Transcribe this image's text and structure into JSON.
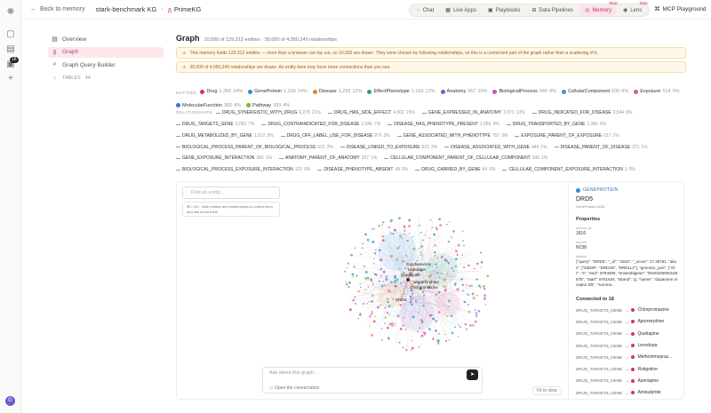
{
  "topbar": {
    "back_label": "Back to memory",
    "memory_name": "stark-benchmark KG",
    "current": "PrimeKG",
    "tabs": [
      {
        "label": "Chat",
        "beta": ""
      },
      {
        "label": "Live Apps",
        "beta": ""
      },
      {
        "label": "Playbooks",
        "beta": ""
      },
      {
        "label": "Data Pipelines",
        "beta": ""
      },
      {
        "label": "Memory",
        "beta": "Beta"
      },
      {
        "label": "Lens",
        "beta": "Beta"
      }
    ],
    "active_tab": "Memory",
    "mcp_label": "MCP Playground"
  },
  "rail": {
    "badge": "18",
    "avatar": "G"
  },
  "sidebar": {
    "items": [
      {
        "label": "Overview",
        "icon": "overview-icon"
      },
      {
        "label": "Graph",
        "icon": "graph-icon"
      },
      {
        "label": "Graph Query Builder",
        "icon": "query-icon"
      }
    ],
    "tables_label": "TABLES",
    "tables_count": "44"
  },
  "page": {
    "title": "Graph",
    "subtitle": "10,000 of 129,312 entities · 30,000 of 4,050,249 relationships",
    "warn1": "This memory holds 129,312 entities — more than a browser can lay out, so 10,000 are drawn. They were chosen by following relationships, so this is a connected part of the graph rather than a scattering of it.",
    "warn2": "30,000 of 4,050,249 relationships are drawn. An entity here may have more connections than you see."
  },
  "entities_label": "ENTITIES",
  "entities": [
    {
      "name": "Drug",
      "count": "2,356",
      "pct": "24%",
      "color": "#d6335a"
    },
    {
      "name": "GeneProtein",
      "count": "1,334",
      "pct": "14%",
      "color": "#2d8fd5"
    },
    {
      "name": "Disease",
      "count": "1,259",
      "pct": "12%",
      "color": "#e9822e"
    },
    {
      "name": "EffectPhenotype",
      "count": "1,160",
      "pct": "12%",
      "color": "#1fa58a"
    },
    {
      "name": "Anatomy",
      "count": "957",
      "pct": "10%",
      "color": "#7a5bd6"
    },
    {
      "name": "BiologicalProcess",
      "count": "946",
      "pct": "9%",
      "color": "#d64fb0"
    },
    {
      "name": "CellularComponent",
      "count": "636",
      "pct": "6%",
      "color": "#2fa0b8"
    },
    {
      "name": "Exposure",
      "count": "514",
      "pct": "5%",
      "color": "#e0549a"
    },
    {
      "name": "MolecularFunction",
      "count": "365",
      "pct": "4%",
      "color": "#3d6fd8"
    },
    {
      "name": "Pathway",
      "count": "393",
      "pct": "4%",
      "color": "#7ab82e"
    }
  ],
  "relationships_label": "RELATIONSHIPS",
  "relationships": [
    {
      "name": "DRUG_SYNERGISTIC_WITH_DRUG",
      "count": "6,278",
      "pct": "21%"
    },
    {
      "name": "DRUG_HAS_SIDE_EFFECT",
      "count": "4,502",
      "pct": "15%"
    },
    {
      "name": "GENE_EXPRESSED_IN_ANATOMY",
      "count": "3,971",
      "pct": "13%"
    },
    {
      "name": "DRUG_INDICATED_FOR_DISEASE",
      "count": "2,544",
      "pct": "8%"
    },
    {
      "name": "DRUG_TARGETS_GENE",
      "count": "2,082",
      "pct": "7%"
    },
    {
      "name": "DRUG_CONTRAINDICATED_FOR_DISEASE",
      "count": "2,046",
      "pct": "7%"
    },
    {
      "name": "DISEASE_HAS_PHENOTYPE_PRESENT",
      "count": "1,083",
      "pct": "4%"
    },
    {
      "name": "DRUG_TRANSPORTED_BY_GENE",
      "count": "1,080",
      "pct": "4%"
    },
    {
      "name": "DRUG_METABOLIZED_BY_GENE",
      "count": "1,012",
      "pct": "3%"
    },
    {
      "name": "DRUG_OFF_LABEL_USE_FOR_DISEASE",
      "count": "876",
      "pct": "3%"
    },
    {
      "name": "GENE_ASSOCIATED_WITH_PHENOTYPE",
      "count": "797",
      "pct": "3%"
    },
    {
      "name": "EXPOSURE_PARENT_OF_EXPOSURE",
      "count": "617",
      "pct": "2%"
    },
    {
      "name": "BIOLOGICAL_PROCESS_PARENT_OF_BIOLOGICAL_PROCESS",
      "count": "615",
      "pct": "2%"
    },
    {
      "name": "DISEASE_LINKED_TO_EXPOSURE",
      "count": "533",
      "pct": "2%"
    },
    {
      "name": "DISEASE_ASSOCIATED_WITH_GENE",
      "count": "444",
      "pct": "1%"
    },
    {
      "name": "DISEASE_PARENT_OF_DISEASE",
      "count": "371",
      "pct": "1%"
    },
    {
      "name": "GENE_EXPOSURE_INTERACTION",
      "count": "366",
      "pct": "1%"
    },
    {
      "name": "ANATOMY_PARENT_OF_ANATOMY",
      "count": "327",
      "pct": "1%"
    },
    {
      "name": "CELLULAR_COMPONENT_PARENT_OF_CELLULAR_COMPONENT",
      "count": "340",
      "pct": "1%"
    },
    {
      "name": "BIOLOGICAL_PROCESS_EXPOSURE_INTERACTION",
      "count": "122",
      "pct": "0%"
    },
    {
      "name": "DISEASE_PHENOTYPE_ABSENT",
      "count": "49",
      "pct": "0%"
    },
    {
      "name": "DRUG_CARRIED_BY_GENE",
      "count": "44",
      "pct": "0%"
    },
    {
      "name": "CELLULAR_COMPONENT_EXPOSURE_INTERACTION",
      "count": "1",
      "pct": "0%"
    }
  ],
  "graph": {
    "search_placeholder": "Find an entity...",
    "hint": "⌘ / Ctrl · click entities and relationships to collect them and ask about them",
    "node_labels": [
      "Carphenazine",
      "Levodopa",
      "Quetiapine",
      "Apomorphine",
      "Chlorpromazine",
      "DRD5"
    ],
    "ask_placeholder": "Ask about this graph...",
    "open_conversation": "Open the conversation",
    "fit_label": "Fit to view"
  },
  "details": {
    "type": "GENEPROTEIN",
    "name": "DRD5",
    "id": "GeneProtein:1816",
    "props_heading": "Properties",
    "props": [
      {
        "key": "source_id",
        "value": "1816"
      },
      {
        "key": "source",
        "value": "NCBI"
      }
    ],
    "details_key": "details",
    "details_value": "{\"query\": \"DRD5\", \"_id\": \"1816\", \"_score\": 17.38761, \"alias\": [\"DBDR\", \"DRD1B\", \"DRD1L2\"], \"genomic_pos\": {\"chr\": \"4\", \"end\": 9784009, \"ensemblgene\": \"ENSG00000169676\", \"start\": 9781634, \"strand\": 1}, \"name\": \"dopamine receptor D5\", \"summa...",
    "connected_label": "Connected to",
    "connected_count": "18",
    "connections": [
      {
        "rel": "DRUG_TARGETS_GENE",
        "target": "Chlorpromazine"
      },
      {
        "rel": "DRUG_TARGETS_GENE",
        "target": "Apomorphine"
      },
      {
        "rel": "DRUG_TARGETS_GENE",
        "target": "Quetiapine"
      },
      {
        "rel": "DRUG_TARGETS_GENE",
        "target": "Levodopa"
      },
      {
        "rel": "DRUG_TARGETS_GENE",
        "target": "Methotrimepraz..."
      },
      {
        "rel": "DRUG_TARGETS_GENE",
        "target": "Rotigotine"
      },
      {
        "rel": "DRUG_TARGETS_GENE",
        "target": "Asenapine"
      },
      {
        "rel": "DRUG_TARGETS_GENE",
        "target": "Amisulpride"
      }
    ]
  }
}
